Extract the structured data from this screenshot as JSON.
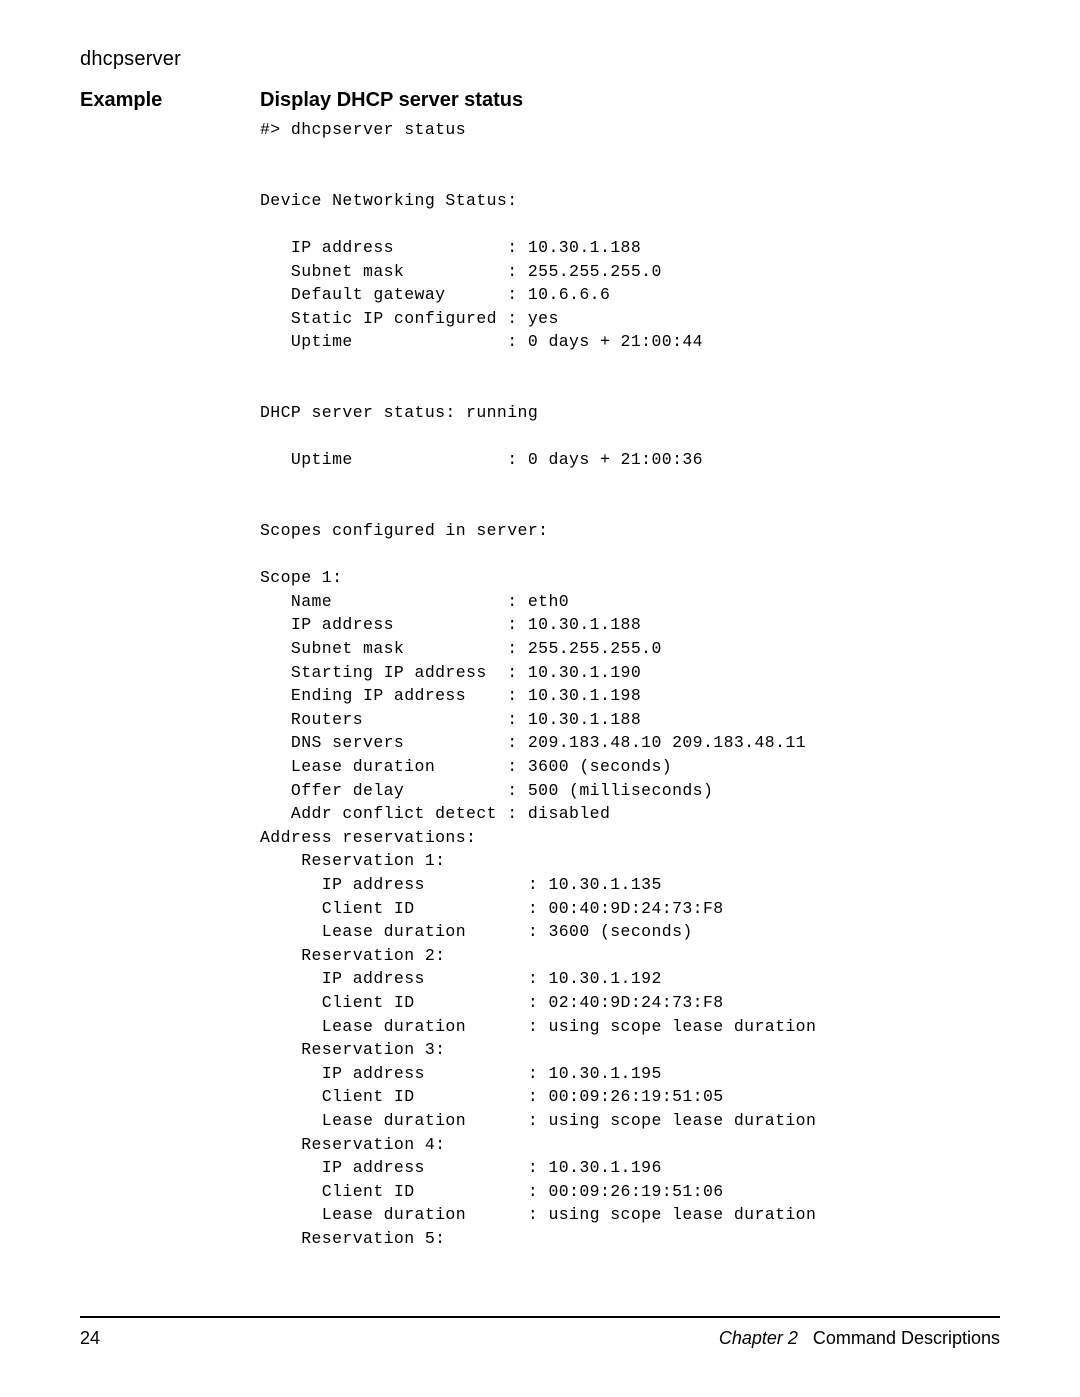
{
  "header": {
    "command": "dhcpserver"
  },
  "left": {
    "example_label": "Example"
  },
  "right": {
    "subhead": "Display DHCP server status",
    "terminal": "#> dhcpserver status\n\n\nDevice Networking Status:\n\n   IP address           : 10.30.1.188\n   Subnet mask          : 255.255.255.0\n   Default gateway      : 10.6.6.6\n   Static IP configured : yes\n   Uptime               : 0 days + 21:00:44\n\n\nDHCP server status: running\n\n   Uptime               : 0 days + 21:00:36\n\n\nScopes configured in server:\n\nScope 1:\n   Name                 : eth0\n   IP address           : 10.30.1.188\n   Subnet mask          : 255.255.255.0\n   Starting IP address  : 10.30.1.190\n   Ending IP address    : 10.30.1.198\n   Routers              : 10.30.1.188\n   DNS servers          : 209.183.48.10 209.183.48.11\n   Lease duration       : 3600 (seconds)\n   Offer delay          : 500 (milliseconds)\n   Addr conflict detect : disabled\nAddress reservations:\n    Reservation 1:\n      IP address          : 10.30.1.135\n      Client ID           : 00:40:9D:24:73:F8\n      Lease duration      : 3600 (seconds)\n    Reservation 2:\n      IP address          : 10.30.1.192\n      Client ID           : 02:40:9D:24:73:F8\n      Lease duration      : using scope lease duration\n    Reservation 3:\n      IP address          : 10.30.1.195\n      Client ID           : 00:09:26:19:51:05\n      Lease duration      : using scope lease duration\n    Reservation 4:\n      IP address          : 10.30.1.196\n      Client ID           : 00:09:26:19:51:06\n      Lease duration      : using scope lease duration\n    Reservation 5:"
  },
  "footer": {
    "page_number": "24",
    "chapter_label": "Chapter 2",
    "chapter_title": "Command Descriptions"
  }
}
